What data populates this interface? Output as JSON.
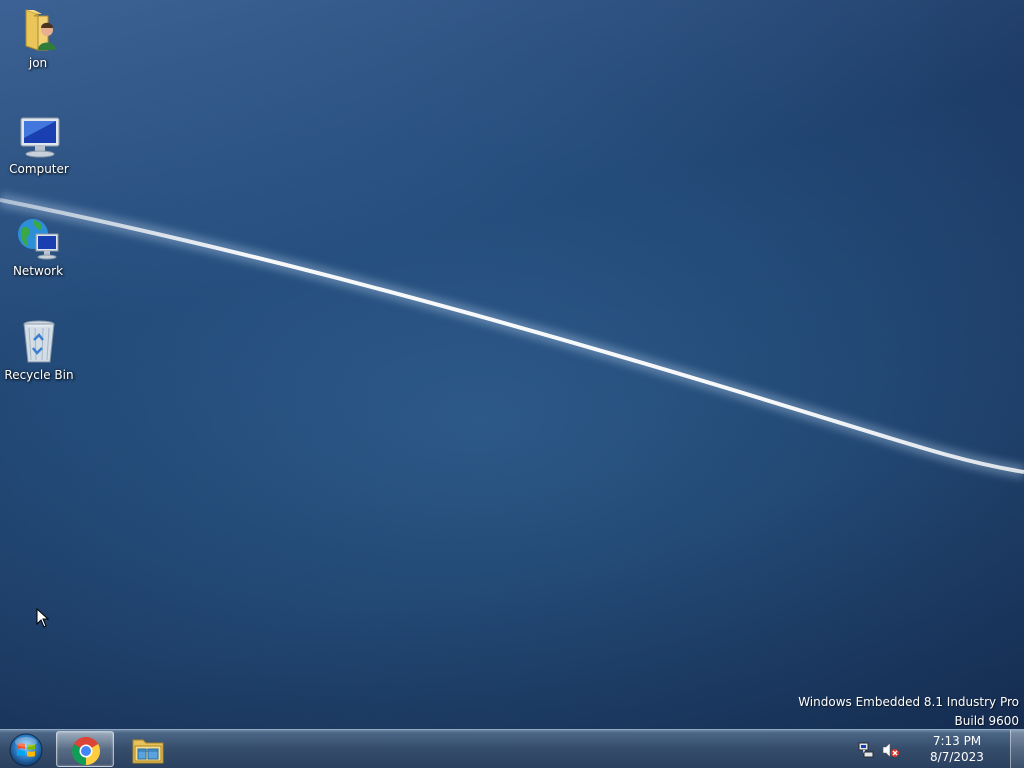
{
  "desktop": {
    "icons": [
      {
        "label": "jon",
        "icon": "user-folder-icon"
      },
      {
        "label": "Computer",
        "icon": "computer-icon"
      },
      {
        "label": "Network",
        "icon": "network-icon"
      },
      {
        "label": "Recycle Bin",
        "icon": "recycle-bin-icon"
      }
    ],
    "watermark": {
      "line1": "Windows Embedded 8.1 Industry Pro",
      "line2": "Build 9600"
    }
  },
  "taskbar": {
    "start_icon": "windows-start-icon",
    "pinned": [
      {
        "name": "Google Chrome",
        "icon": "chrome-icon",
        "active": true
      },
      {
        "name": "File Explorer",
        "icon": "file-explorer-icon",
        "active": false
      }
    ],
    "tray": {
      "network_icon": "network-tray-icon",
      "volume_icon": "volume-muted-icon",
      "time": "7:13 PM",
      "date": "8/7/2023"
    }
  },
  "colors": {
    "desktop_top": "#3f74aa",
    "desktop_bottom": "#152a4d",
    "taskbar": "#354d6b"
  }
}
